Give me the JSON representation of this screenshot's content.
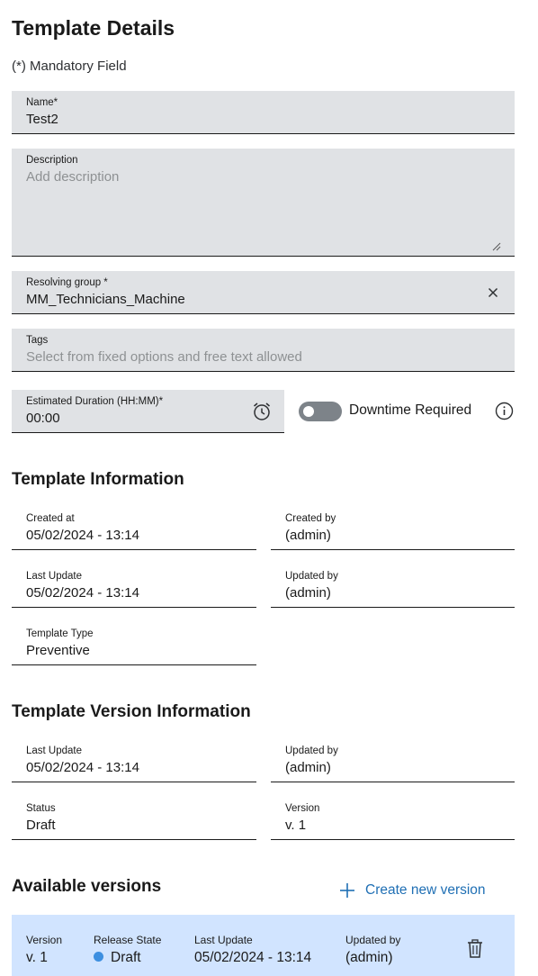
{
  "page": {
    "title": "Template Details",
    "mandatory_note": "(*) Mandatory Field"
  },
  "form": {
    "name": {
      "label": "Name*",
      "value": "Test2"
    },
    "description": {
      "label": "Description",
      "placeholder": "Add description"
    },
    "resolving_group": {
      "label": "Resolving group *",
      "value": "MM_Technicians_Machine"
    },
    "tags": {
      "label": "Tags",
      "placeholder": "Select from fixed options and free text allowed"
    },
    "estimated_duration": {
      "label": "Estimated Duration (HH:MM)*",
      "value": "00:00"
    },
    "downtime": {
      "label": "Downtime Required",
      "checked": false
    }
  },
  "template_info": {
    "title": "Template Information",
    "created_at": {
      "label": "Created at",
      "value": "05/02/2024 - 13:14"
    },
    "created_by": {
      "label": "Created by",
      "value": "(admin)"
    },
    "last_update": {
      "label": "Last Update",
      "value": "05/02/2024 - 13:14"
    },
    "updated_by": {
      "label": "Updated by",
      "value": "(admin)"
    },
    "template_type": {
      "label": "Template Type",
      "value": "Preventive"
    }
  },
  "version_info": {
    "title": "Template Version Information",
    "last_update": {
      "label": "Last Update",
      "value": "05/02/2024 - 13:14"
    },
    "updated_by": {
      "label": "Updated by",
      "value": "(admin)"
    },
    "status": {
      "label": "Status",
      "value": "Draft"
    },
    "version": {
      "label": "Version",
      "value": "v. 1"
    }
  },
  "available_versions": {
    "title": "Available versions",
    "create_label": "Create new version",
    "columns": {
      "version": "Version",
      "release_state": "Release State",
      "last_update": "Last Update",
      "updated_by": "Updated by"
    },
    "rows": [
      {
        "version": "v. 1",
        "release_state": "Draft",
        "last_update": "05/02/2024 - 13:14",
        "updated_by": "(admin)"
      }
    ]
  },
  "colors": {
    "field_bg": "#e0e2e5",
    "accent": "#1f6fb4",
    "selected_row": "#d1e4ff",
    "draft_dot": "#3d8fe0",
    "toggle_off": "#7d8389"
  }
}
